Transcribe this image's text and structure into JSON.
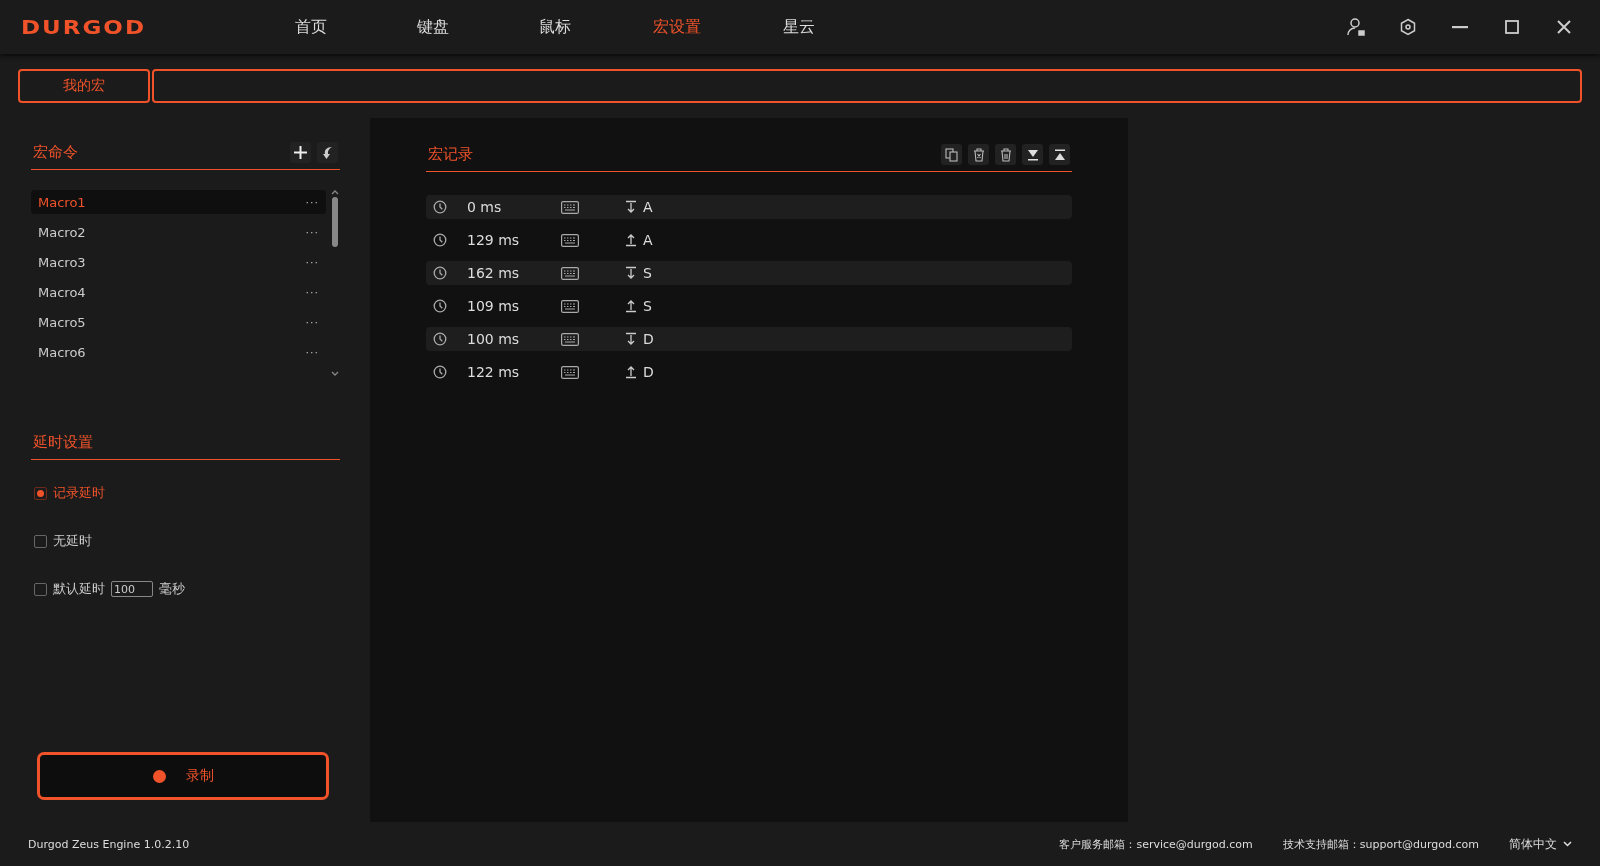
{
  "app": {
    "logo": "DURGOD"
  },
  "nav": [
    {
      "label": "首页",
      "selected": false
    },
    {
      "label": "键盘",
      "selected": false
    },
    {
      "label": "鼠标",
      "selected": false
    },
    {
      "label": "宏设置",
      "selected": true
    },
    {
      "label": "星云",
      "selected": false
    }
  ],
  "subtabs": [
    {
      "label": "我的宏",
      "selected": true
    }
  ],
  "macro_commands": {
    "title": "宏命令",
    "items": [
      {
        "name": "Macro1",
        "more": "···",
        "selected": true
      },
      {
        "name": "Macro2",
        "more": "···",
        "selected": false
      },
      {
        "name": "Macro3",
        "more": "···",
        "selected": false
      },
      {
        "name": "Macro4",
        "more": "···",
        "selected": false
      },
      {
        "name": "Macro5",
        "more": "···",
        "selected": false
      },
      {
        "name": "Macro6",
        "more": "···",
        "selected": false
      }
    ]
  },
  "delay_settings": {
    "title": "延时设置",
    "options": [
      {
        "kind": "plain",
        "label": "记录延时",
        "checked": true
      },
      {
        "kind": "plain",
        "label": "无延时",
        "checked": false
      },
      {
        "kind": "field",
        "label": "默认延时",
        "checked": false,
        "value": "100",
        "unit": "毫秒"
      }
    ]
  },
  "record_button": {
    "label": "录制"
  },
  "macro_record": {
    "title": "宏记录",
    "events": [
      {
        "delay": "0 ms",
        "pressed": true,
        "key": "A"
      },
      {
        "delay": "129 ms",
        "pressed": false,
        "key": "A"
      },
      {
        "delay": "162 ms",
        "pressed": true,
        "key": "S"
      },
      {
        "delay": "109 ms",
        "pressed": false,
        "key": "S"
      },
      {
        "delay": "100 ms",
        "pressed": true,
        "key": "D"
      },
      {
        "delay": "122 ms",
        "pressed": false,
        "key": "D"
      }
    ]
  },
  "status_bar": {
    "version": "Durgod Zeus Engine 1.0.2.10",
    "service": "客户服务邮箱：service@durgod.com",
    "support": "技术支持邮箱：support@durgod.com",
    "language": "简体中文"
  }
}
